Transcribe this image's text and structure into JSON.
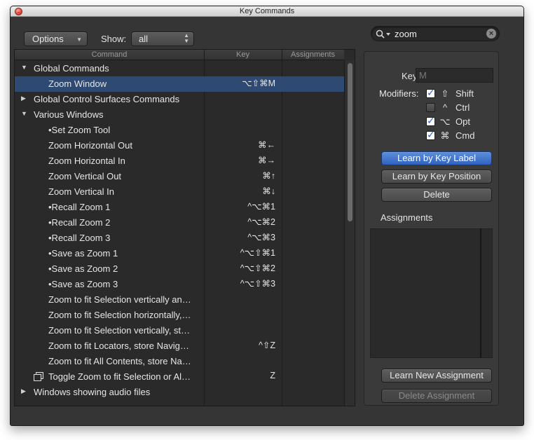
{
  "window": {
    "title": "Key Commands"
  },
  "toolbar": {
    "options_label": "Options",
    "show_label": "Show:",
    "show_value": "all",
    "search_value": "zoom"
  },
  "table": {
    "columns": [
      "Command",
      "Key",
      "Assignments"
    ],
    "rows": [
      {
        "command": "Global Commands",
        "key": "",
        "indent": 0,
        "disclosure": "open",
        "selected": false
      },
      {
        "command": "Zoom Window",
        "key": "⌥⇧⌘M",
        "indent": 2,
        "disclosure": "",
        "selected": true
      },
      {
        "command": "Global Control Surfaces Commands",
        "key": "",
        "indent": 0,
        "disclosure": "closed",
        "selected": false
      },
      {
        "command": "Various Windows",
        "key": "",
        "indent": 0,
        "disclosure": "open",
        "selected": false
      },
      {
        "command": "•Set Zoom Tool",
        "key": "",
        "indent": 2,
        "disclosure": "",
        "selected": false
      },
      {
        "command": "Zoom Horizontal Out",
        "key": "⌘←",
        "indent": 2,
        "disclosure": "",
        "selected": false
      },
      {
        "command": "Zoom Horizontal In",
        "key": "⌘→",
        "indent": 2,
        "disclosure": "",
        "selected": false
      },
      {
        "command": "Zoom Vertical Out",
        "key": "⌘↑",
        "indent": 2,
        "disclosure": "",
        "selected": false
      },
      {
        "command": "Zoom Vertical In",
        "key": "⌘↓",
        "indent": 2,
        "disclosure": "",
        "selected": false
      },
      {
        "command": "•Recall Zoom 1",
        "key": "^⌥⌘1",
        "indent": 2,
        "disclosure": "",
        "selected": false
      },
      {
        "command": "•Recall Zoom 2",
        "key": "^⌥⌘2",
        "indent": 2,
        "disclosure": "",
        "selected": false
      },
      {
        "command": "•Recall Zoom 3",
        "key": "^⌥⌘3",
        "indent": 2,
        "disclosure": "",
        "selected": false
      },
      {
        "command": "•Save as Zoom 1",
        "key": "^⌥⇧⌘1",
        "indent": 2,
        "disclosure": "",
        "selected": false
      },
      {
        "command": "•Save as Zoom 2",
        "key": "^⌥⇧⌘2",
        "indent": 2,
        "disclosure": "",
        "selected": false
      },
      {
        "command": "•Save as Zoom 3",
        "key": "^⌥⇧⌘3",
        "indent": 2,
        "disclosure": "",
        "selected": false
      },
      {
        "command": "Zoom to fit Selection vertically an…",
        "key": "",
        "indent": 2,
        "disclosure": "",
        "selected": false
      },
      {
        "command": "Zoom to fit Selection horizontally,…",
        "key": "",
        "indent": 2,
        "disclosure": "",
        "selected": false
      },
      {
        "command": "Zoom to fit Selection vertically, st…",
        "key": "",
        "indent": 2,
        "disclosure": "",
        "selected": false
      },
      {
        "command": "Zoom to fit Locators, store Navig…",
        "key": "^⇧Z",
        "indent": 2,
        "disclosure": "",
        "selected": false
      },
      {
        "command": "Zoom to fit All Contents, store Na…",
        "key": "",
        "indent": 2,
        "disclosure": "",
        "selected": false
      },
      {
        "command": "Toggle Zoom to fit Selection or Al…",
        "key": "Z",
        "indent": 2,
        "disclosure": "",
        "selected": false,
        "icon": "toggle-windows-icon"
      },
      {
        "command": "Windows showing audio files",
        "key": "",
        "indent": 0,
        "disclosure": "closed",
        "selected": false
      }
    ]
  },
  "panel": {
    "key_label": "Key:",
    "key_value": "M",
    "modifiers_label": "Modifiers:",
    "modifiers": [
      {
        "symbol": "⇧",
        "label": "Shift",
        "checked": true
      },
      {
        "symbol": "^",
        "label": "Ctrl",
        "checked": false
      },
      {
        "symbol": "⌥",
        "label": "Opt",
        "checked": true
      },
      {
        "symbol": "⌘",
        "label": "Cmd",
        "checked": true
      }
    ],
    "learn_label_button": "Learn by Key Label",
    "learn_position_button": "Learn by Key Position",
    "delete_button": "Delete",
    "assignments_label": "Assignments",
    "learn_new_button": "Learn New Assignment",
    "delete_assignment_button": "Delete Assignment"
  },
  "colors": {
    "accent": "#2f62c0",
    "selection": "#2e4a72",
    "background": "#353535"
  }
}
